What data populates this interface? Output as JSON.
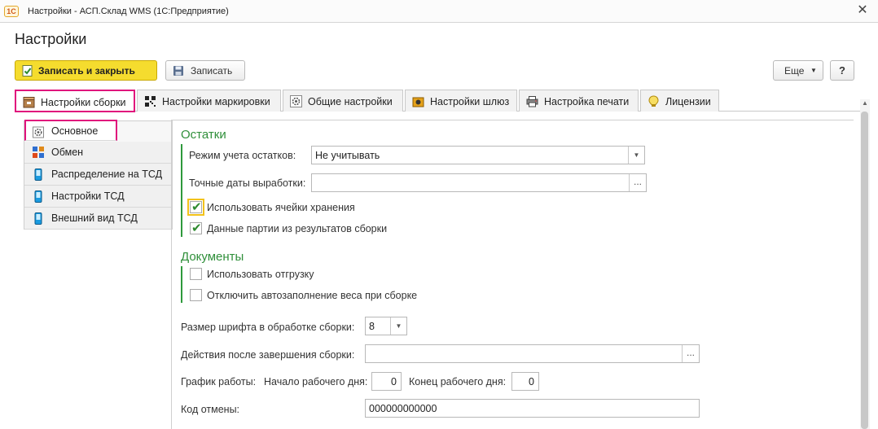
{
  "window": {
    "logo_text": "1С",
    "title": "Настройки - АСП.Склад WMS  (1С:Предприятие)",
    "close_glyph": "✕"
  },
  "page_title": "Настройки",
  "toolbar": {
    "save_close_label": "Записать и закрыть",
    "save_label": "Записать",
    "more_label": "Еще",
    "help_label": "?"
  },
  "tabs": [
    {
      "label": "Настройки сборки",
      "icon": "box-icon",
      "active": true
    },
    {
      "label": "Настройки маркировки",
      "icon": "qr-code-icon"
    },
    {
      "label": "Общие настройки",
      "icon": "gear-icon"
    },
    {
      "label": "Настройки шлюз",
      "icon": "gateway-icon"
    },
    {
      "label": "Настройка печати",
      "icon": "printer-icon"
    },
    {
      "label": "Лицензии",
      "icon": "license-icon"
    }
  ],
  "nav": [
    {
      "label": "Основное",
      "icon": "gear-icon",
      "active": true
    },
    {
      "label": "Обмен",
      "icon": "exchange-icon"
    },
    {
      "label": "Распределение на ТСД",
      "icon": "device-icon"
    },
    {
      "label": "Настройки ТСД",
      "icon": "device-icon"
    },
    {
      "label": "Внешний вид ТСД",
      "icon": "device-icon"
    }
  ],
  "stock": {
    "title": "Остатки",
    "mode_label": "Режим учета остатков:",
    "mode_value": "Не учитывать",
    "dates_label": "Точные даты выработки:",
    "dates_value": "",
    "use_cells_label": "Использовать ячейки хранения",
    "use_cells_checked": true,
    "batch_label": "Данные партии из результатов сборки",
    "batch_checked": true
  },
  "docs": {
    "title": "Документы",
    "shipment_label": "Использовать отгрузку",
    "shipment_checked": false,
    "weight_label": "Отключить автозаполнение веса при сборке",
    "weight_checked": false
  },
  "font_size_label": "Размер шрифта в обработке сборки:",
  "font_size_value": "8",
  "after_actions_label": "Действия после завершения сборки:",
  "after_actions_value": "",
  "schedule": {
    "label": "График работы:",
    "start_label": "Начало рабочего дня:",
    "start_value": "0",
    "end_label": "Конец рабочего дня:",
    "end_value": "0"
  },
  "cancel_code_label": "Код отмены:",
  "cancel_code_value": "000000000000",
  "colors": {
    "accent_green": "#2f8f3a",
    "highlight_pink": "#e0127c",
    "primary_button": "#f5dc2e"
  }
}
